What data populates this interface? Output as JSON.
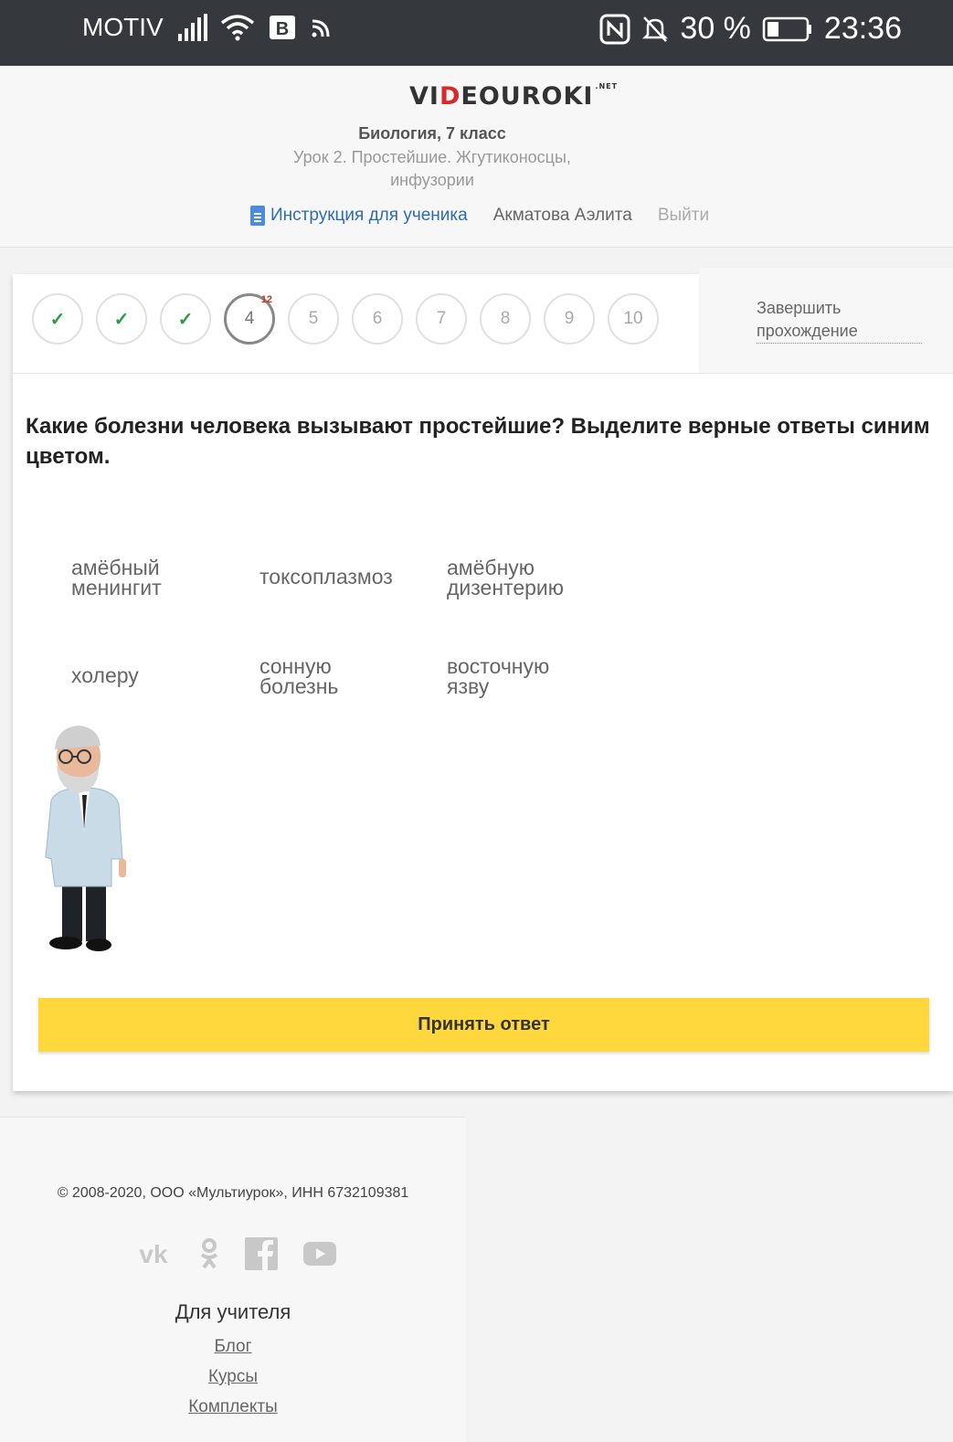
{
  "status_bar": {
    "carrier": "MOTIV",
    "battery": "30 %",
    "time": "23:36",
    "icons": [
      "signal-icon",
      "wifi-icon",
      "b-badge-icon",
      "cast-icon",
      "nfc-icon",
      "bell-off-icon",
      "battery-icon"
    ]
  },
  "header": {
    "logo_text_a": "VI",
    "logo_text_d": "D",
    "logo_text_b": "EOUROKI",
    "logo_suffix": ".NET",
    "course": "Биология, 7 класс",
    "lesson": "Урок 2. Простейшие. Жгутиконосцы, инфузории",
    "instruction_link": "Инструкция для ученика",
    "user_name": "Акматова Аэлита",
    "logout": "Выйти"
  },
  "quiz": {
    "steps": [
      {
        "label": "",
        "state": "done"
      },
      {
        "label": "",
        "state": "done"
      },
      {
        "label": "",
        "state": "done"
      },
      {
        "label": "4",
        "state": "current",
        "badge": "12"
      },
      {
        "label": "5",
        "state": "pending"
      },
      {
        "label": "6",
        "state": "pending"
      },
      {
        "label": "7",
        "state": "pending"
      },
      {
        "label": "8",
        "state": "pending"
      },
      {
        "label": "9",
        "state": "pending"
      },
      {
        "label": "10",
        "state": "pending"
      }
    ],
    "finish_label": "Завершить прохождение",
    "question": "Какие болезни человека вызывают простейшие? Выделите верные ответы синим цветом.",
    "options": [
      {
        "line1": "амёбный",
        "line2": "менингит"
      },
      {
        "line1": "токсоплазмоз",
        "line2": ""
      },
      {
        "line1": "амёбную",
        "line2": "дизентерию"
      },
      {
        "line1": "холеру",
        "line2": ""
      },
      {
        "line1": "сонную",
        "line2": "болезнь"
      },
      {
        "line1": "восточную",
        "line2": "язву"
      }
    ],
    "submit_label": "Принять ответ"
  },
  "footer": {
    "copyright": "© 2008-2020, ООО «Мультиурок», ИНН 6732109381",
    "socials": [
      "vk-icon",
      "odnoklassniki-icon",
      "facebook-icon",
      "youtube-icon"
    ],
    "section_title": "Для учителя",
    "links": [
      "Блог",
      "Курсы",
      "Комплекты"
    ]
  },
  "colors": {
    "status_bar_bg": "#35383d",
    "accent_yellow": "#fed83c",
    "check_green": "#2e9b43",
    "badge_red": "#c0392b",
    "link_blue": "#2d6bb0"
  }
}
